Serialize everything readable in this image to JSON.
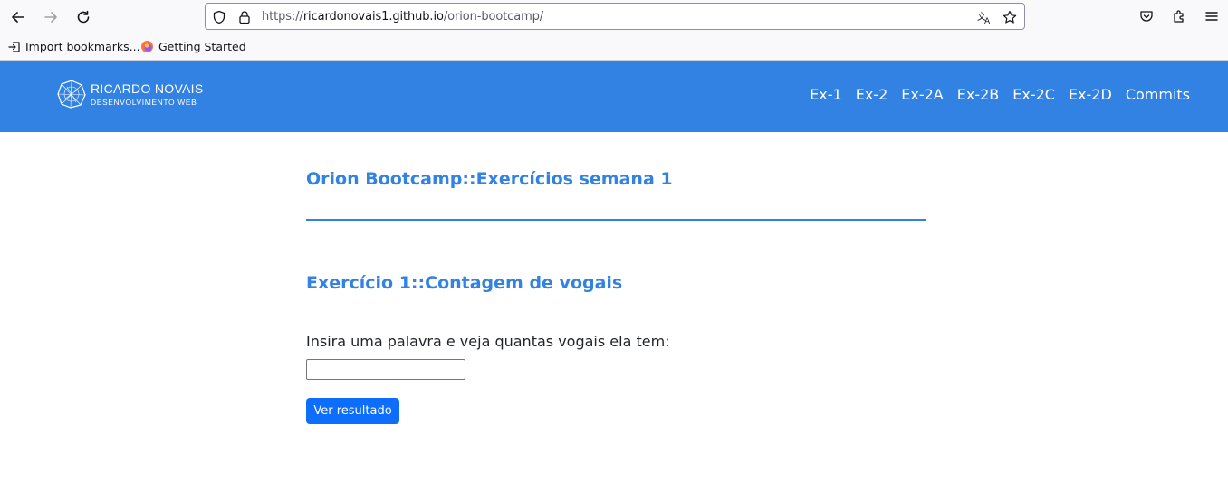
{
  "browser": {
    "url_scheme": "https://",
    "url_host": "ricardonovais1.github.io",
    "url_path": "/orion-bootcamp/",
    "bookmarks": [
      {
        "label": "Import bookmarks..."
      },
      {
        "label": "Getting Started"
      }
    ]
  },
  "site": {
    "logo_title": "RICARDO NOVAIS",
    "logo_subtitle": "DESENVOLVIMENTO WEB",
    "nav": [
      {
        "label": "Ex-1"
      },
      {
        "label": "Ex-2"
      },
      {
        "label": "Ex-2A"
      },
      {
        "label": "Ex-2B"
      },
      {
        "label": "Ex-2C"
      },
      {
        "label": "Ex-2D"
      },
      {
        "label": "Commits"
      }
    ],
    "header_color": "#3182e2"
  },
  "main": {
    "page_title": "Orion Bootcamp::Exercícios semana 1",
    "section_title": "Exercício 1::Contagem de vogais",
    "prompt": "Insira uma palavra e veja quantas vogais ela tem:",
    "input_value": "",
    "button_label": "Ver resultado",
    "accent_color": "#3182e2",
    "button_color": "#0d6efd"
  }
}
